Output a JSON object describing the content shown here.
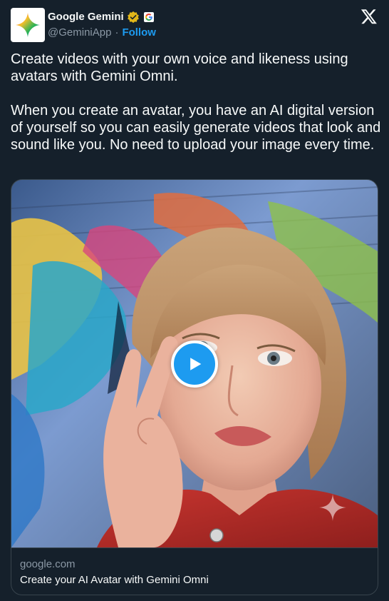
{
  "author": {
    "display_name": "Google Gemini",
    "handle": "@GeminiApp",
    "separator": "·",
    "follow_label": "Follow",
    "verified_badge_color": "#e2b719",
    "avatar_icon": "gemini-sparkle-icon"
  },
  "tweet": {
    "paragraphs": [
      "Create videos with your own voice and likeness using avatars with Gemini Omni.",
      "When you create an avatar, you have an AI digital version of yourself so you can easily generate videos that look and sound like you. No need to upload your image every time."
    ]
  },
  "link_card": {
    "domain": "google.com",
    "title": "Create your AI Avatar with Gemini Omni",
    "media_icon": "play-icon"
  },
  "colors": {
    "background": "#15202b",
    "accent": "#1d9bf0",
    "muted_text": "#8b98a5",
    "border": "#38444d"
  }
}
